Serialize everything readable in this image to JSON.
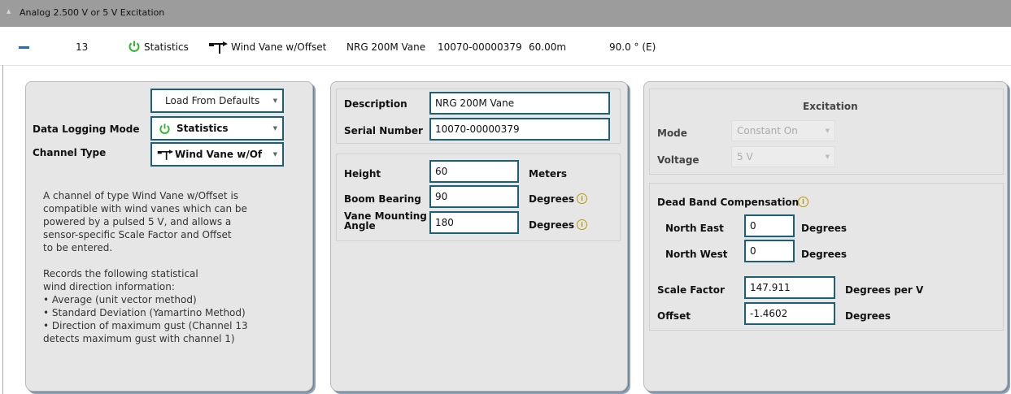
{
  "section": {
    "title": "Analog 2.500 V or 5 V Excitation"
  },
  "channel_row": {
    "number": "13",
    "mode": "Statistics",
    "type": "Wind Vane w/Offset",
    "model": "NRG 200M Vane",
    "serial": "10070-00000379",
    "height": "60.00m",
    "bearing": "90.0 ° (E)"
  },
  "left_panel": {
    "load_defaults": "Load From Defaults",
    "data_logging_mode_label": "Data Logging Mode",
    "data_logging_mode_value": "Statistics",
    "channel_type_label": "Channel Type",
    "channel_type_value": "Wind Vane w/Of",
    "desc_lines": [
      "A channel of type Wind Vane w/Offset is",
      "compatible with wind vanes which can be",
      "powered by a pulsed 5 V, and allows a",
      "sensor-specific Scale Factor and Offset",
      "to be entered.",
      "",
      "Records the following statistical",
      "wind direction information:",
      "• Average (unit vector method)",
      "• Standard Deviation (Yamartino Method)",
      "• Direction of maximum gust (Channel 13",
      "detects maximum gust with channel 1)"
    ]
  },
  "mid_panel": {
    "description_label": "Description",
    "description_value": "NRG 200M Vane",
    "serial_label": "Serial Number",
    "serial_value": "10070-00000379",
    "height_label": "Height",
    "height_value": "60",
    "height_unit": "Meters",
    "boom_label": "Boom Bearing",
    "boom_value": "90",
    "boom_unit": "Degrees",
    "vane_label_1": "Vane Mounting",
    "vane_label_2": "Angle",
    "vane_value": "180",
    "vane_unit": "Degrees"
  },
  "right_panel": {
    "excitation_title": "Excitation",
    "mode_label": "Mode",
    "mode_value": "Constant On",
    "voltage_label": "Voltage",
    "voltage_value": "5 V",
    "deadband_title": "Dead Band Compensation",
    "ne_label": "North East",
    "ne_value": "0",
    "ne_unit": "Degrees",
    "nw_label": "North West",
    "nw_value": "0",
    "nw_unit": "Degrees",
    "scale_label": "Scale Factor",
    "scale_value": "147.911",
    "scale_unit": "Degrees per V",
    "offset_label": "Offset",
    "offset_value": "-1.4602",
    "offset_unit": "Degrees"
  },
  "colors": {
    "accent_border": "#1b5f79",
    "power_green": "#2db82d",
    "header_gray": "#9c9c9c",
    "info_gold": "#b39a00"
  },
  "icons": [
    "chevron-up-icon",
    "collapse-minus-icon",
    "power-icon",
    "wind-vane-icon",
    "info-icon",
    "dropdown-arrow-icon"
  ]
}
